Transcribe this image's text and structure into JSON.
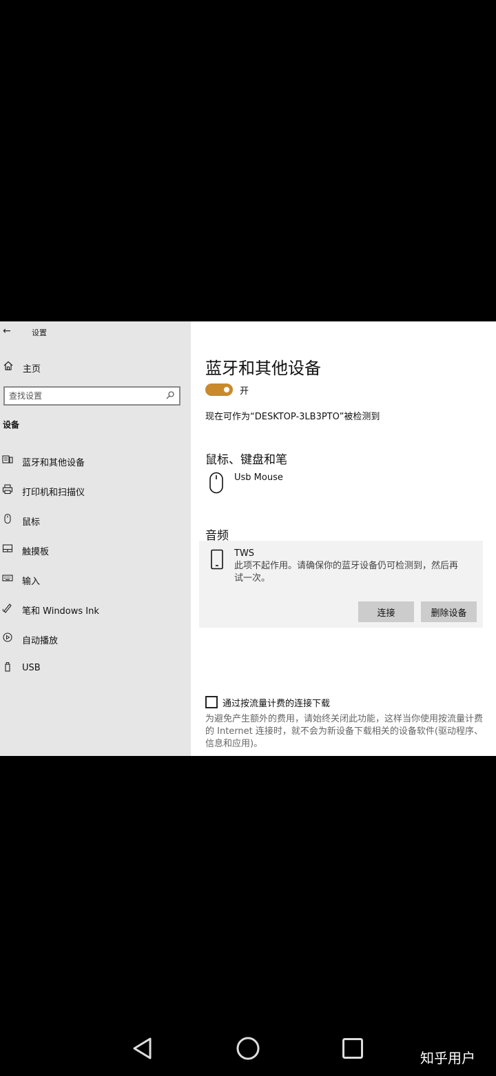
{
  "window": {
    "title": "设置"
  },
  "sidebar": {
    "home_label": "主页",
    "search_placeholder": "查找设置",
    "section_label": "设备",
    "items": [
      {
        "label": "蓝牙和其他设备",
        "icon": "bluetooth-devices-icon"
      },
      {
        "label": "打印机和扫描仪",
        "icon": "printer-icon"
      },
      {
        "label": "鼠标",
        "icon": "mouse-icon"
      },
      {
        "label": "触摸板",
        "icon": "touchpad-icon"
      },
      {
        "label": "输入",
        "icon": "keyboard-icon"
      },
      {
        "label": "笔和 Windows Ink",
        "icon": "pen-icon"
      },
      {
        "label": "自动播放",
        "icon": "autoplay-icon"
      },
      {
        "label": "USB",
        "icon": "usb-icon"
      }
    ]
  },
  "main": {
    "title": "蓝牙和其他设备",
    "toggle": {
      "state_label": "开",
      "on": true,
      "color": "#c98a2c"
    },
    "discoverable_text": "现在可作为“DESKTOP-3LB3PTO”被检测到",
    "mouse_section": {
      "heading": "鼠标、键盘和笔",
      "device_name": "Usb Mouse"
    },
    "audio_section": {
      "heading": "音频",
      "device_name": "TWS",
      "message": "此项不起作用。请确保你的蓝牙设备仍可检测到，然后再试一次。",
      "connect_label": "连接",
      "remove_label": "删除设备"
    },
    "metered": {
      "checkbox_label": "通过按流量计费的连接下载",
      "checked": false,
      "description": "为避免产生额外的费用，请始终关闭此功能，这样当你使用按流量计费的 Internet 连接时，就不会为新设备下载相关的设备软件(驱动程序、信息和应用)。"
    }
  },
  "watermark": "知乎用户"
}
